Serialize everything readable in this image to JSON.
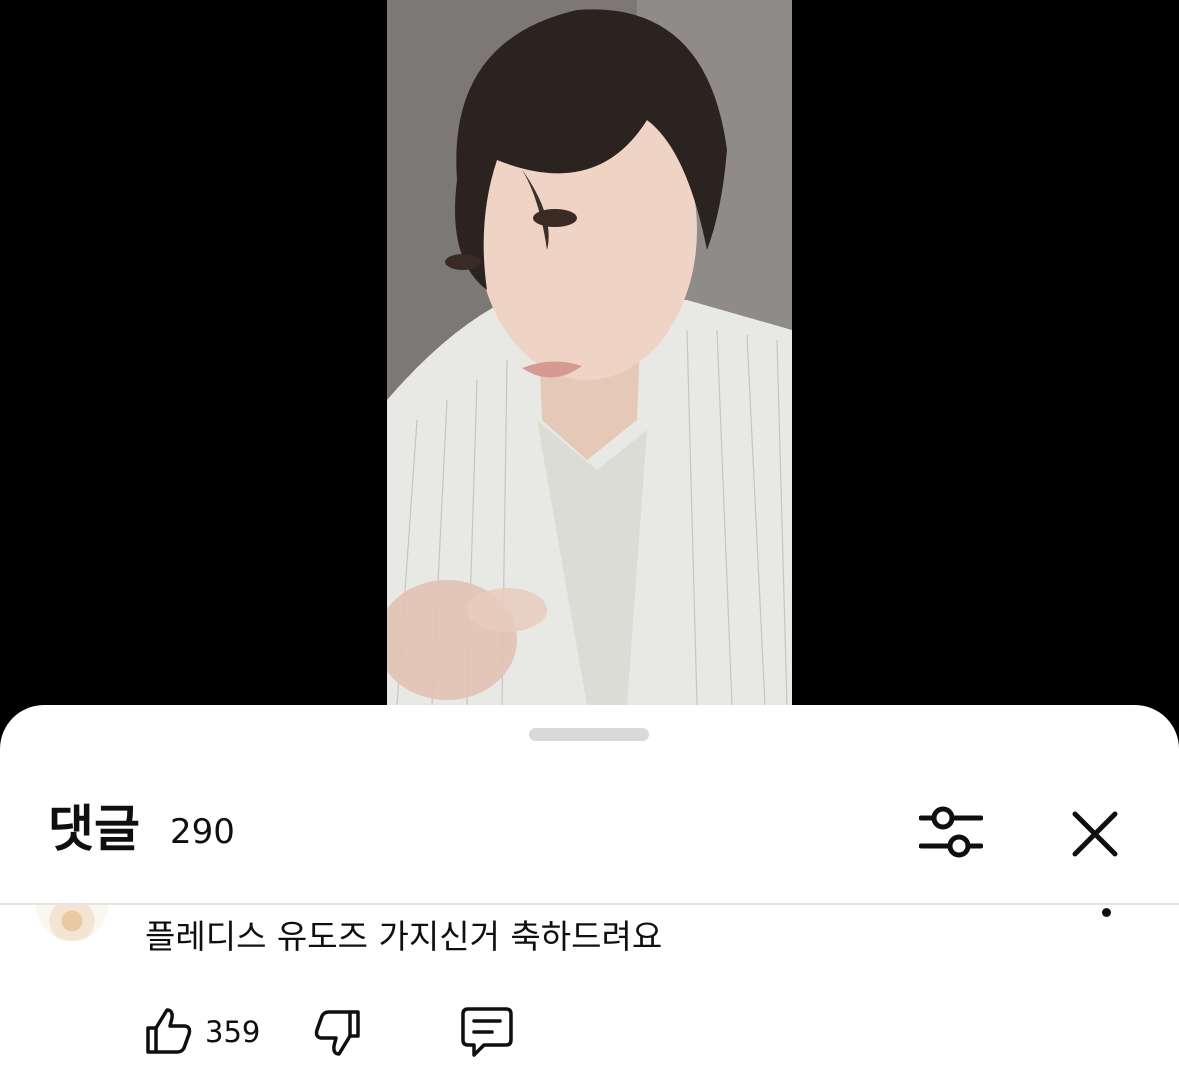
{
  "comments_panel": {
    "title": "댓글",
    "count": "290"
  },
  "comment": {
    "text": "플레디스 유도즈 가지신거 축하드려요",
    "like_count": "359"
  },
  "icons": {
    "filter": "sliders-icon",
    "close": "close-icon",
    "like": "thumbs-up-icon",
    "dislike": "thumbs-down-icon",
    "reply": "reply-comment-icon",
    "more": "more-options-icon"
  },
  "colors": {
    "sheet_background": "#ffffff",
    "text_primary": "#0f0f0f",
    "video_letterbox": "#000000",
    "divider": "#e5e5e5",
    "drag_handle": "#d9d9d9"
  }
}
